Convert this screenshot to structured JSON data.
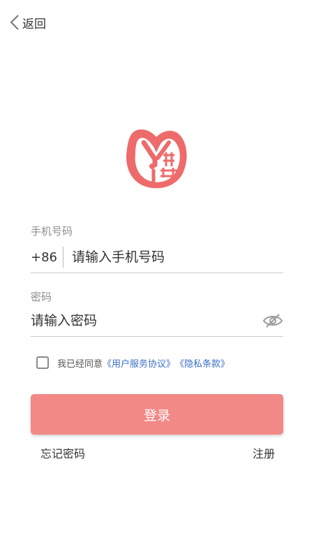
{
  "header": {
    "back_label": "返回",
    "back_icon": "chevron-left-icon"
  },
  "logo": {
    "icon": "app-logo",
    "color": "#ee6b6b"
  },
  "form": {
    "phone_label": "手机号码",
    "country_code": "+86",
    "phone_placeholder": "请输入手机号码",
    "password_label": "密码",
    "password_placeholder": "请输入密码",
    "password_toggle_icon": "eye-off-icon"
  },
  "agreement": {
    "checked": false,
    "prefix": "我已经同意",
    "terms_link": "《用户服务协议》",
    "privacy_link": "《隐私条款》"
  },
  "actions": {
    "login_label": "登录",
    "forgot_label": "忘记密码",
    "register_label": "注册"
  },
  "colors": {
    "primary": "#f28986",
    "link": "#3b6fc6",
    "logo": "#ee6b6b"
  }
}
